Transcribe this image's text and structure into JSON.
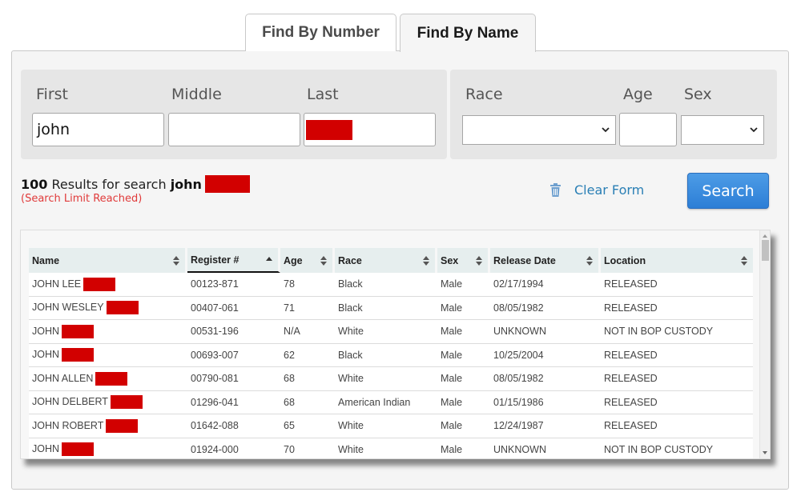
{
  "tabs": [
    {
      "label": "Find By Number",
      "active": false
    },
    {
      "label": "Find By Name",
      "active": true
    }
  ],
  "form": {
    "name_fields": {
      "first": {
        "label": "First",
        "value": "john"
      },
      "middle": {
        "label": "Middle",
        "value": ""
      },
      "last": {
        "label": "Last",
        "value": "[redacted]"
      }
    },
    "demographic_fields": {
      "race": {
        "label": "Race",
        "selected": ""
      },
      "age": {
        "label": "Age",
        "value": ""
      },
      "sex": {
        "label": "Sex",
        "selected": ""
      }
    }
  },
  "results": {
    "count": "100",
    "text": "Results for search",
    "query_first": "john",
    "query_last": "[redacted]",
    "limit_note": "(Search Limit Reached)"
  },
  "actions": {
    "clear_form": "Clear Form",
    "clear_icon": "trash-icon",
    "search": "Search"
  },
  "colors": {
    "search_button": "#2c7ed6",
    "link": "#2a7fb5",
    "limit_warning": "#e03a3a",
    "redaction": "#d20000"
  },
  "table": {
    "columns": [
      {
        "label": "Name",
        "sort": "both"
      },
      {
        "label": "Register #",
        "sort": "asc"
      },
      {
        "label": "Age",
        "sort": "both"
      },
      {
        "label": "Race",
        "sort": "both"
      },
      {
        "label": "Sex",
        "sort": "both"
      },
      {
        "label": "Release Date",
        "sort": "both"
      },
      {
        "label": "Location",
        "sort": "both"
      }
    ],
    "rows": [
      {
        "name": "JOHN LEE",
        "register": "00123-871",
        "age": "78",
        "race": "Black",
        "sex": "Male",
        "release": "02/17/1994",
        "location": "RELEASED"
      },
      {
        "name": "JOHN WESLEY",
        "register": "00407-061",
        "age": "71",
        "race": "Black",
        "sex": "Male",
        "release": "08/05/1982",
        "location": "RELEASED"
      },
      {
        "name": "JOHN",
        "register": "00531-196",
        "age": "N/A",
        "race": "White",
        "sex": "Male",
        "release": "UNKNOWN",
        "location": "NOT IN BOP CUSTODY"
      },
      {
        "name": "JOHN",
        "register": "00693-007",
        "age": "62",
        "race": "Black",
        "sex": "Male",
        "release": "10/25/2004",
        "location": "RELEASED"
      },
      {
        "name": "JOHN ALLEN",
        "register": "00790-081",
        "age": "68",
        "race": "White",
        "sex": "Male",
        "release": "08/05/1982",
        "location": "RELEASED"
      },
      {
        "name": "JOHN DELBERT",
        "register": "01296-041",
        "age": "68",
        "race": "American Indian",
        "sex": "Male",
        "release": "01/15/1986",
        "location": "RELEASED"
      },
      {
        "name": "JOHN ROBERT",
        "register": "01642-088",
        "age": "65",
        "race": "White",
        "sex": "Male",
        "release": "12/24/1987",
        "location": "RELEASED"
      },
      {
        "name": "JOHN",
        "register": "01924-000",
        "age": "70",
        "race": "White",
        "sex": "Male",
        "release": "UNKNOWN",
        "location": "NOT IN BOP CUSTODY"
      }
    ]
  }
}
